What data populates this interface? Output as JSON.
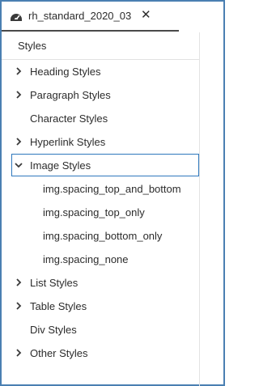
{
  "tab": {
    "icon": "dashboard-gauge-icon",
    "title": "rh_standard_2020_03",
    "close_glyph": "✕"
  },
  "panel": {
    "title": "Styles",
    "items": [
      {
        "label": "Heading Styles",
        "expandable": true,
        "expanded": false
      },
      {
        "label": "Paragraph Styles",
        "expandable": true,
        "expanded": false
      },
      {
        "label": "Character Styles",
        "expandable": false
      },
      {
        "label": "Hyperlink Styles",
        "expandable": true,
        "expanded": false
      },
      {
        "label": "Image Styles",
        "expandable": true,
        "expanded": true,
        "selected": true
      },
      {
        "label": "img.spacing_top_and_bottom",
        "child": true
      },
      {
        "label": "img.spacing_top_only",
        "child": true
      },
      {
        "label": "img.spacing_bottom_only",
        "child": true
      },
      {
        "label": "img.spacing_none",
        "child": true
      },
      {
        "label": "List Styles",
        "expandable": true,
        "expanded": false
      },
      {
        "label": "Table Styles",
        "expandable": true,
        "expanded": false
      },
      {
        "label": "Div Styles",
        "expandable": false
      },
      {
        "label": "Other Styles",
        "expandable": true,
        "expanded": false
      }
    ]
  },
  "colors": {
    "accent": "#2f78bd",
    "frame": "#4a7fb2",
    "text": "#2c2c2c"
  }
}
